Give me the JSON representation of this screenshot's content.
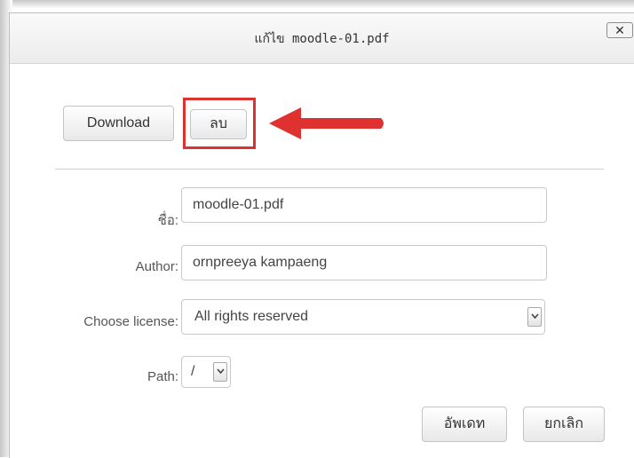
{
  "dialog": {
    "title": "แก้ไข moodle-01.pdf",
    "close_label": "✕"
  },
  "actions": {
    "download_label": "Download",
    "delete_label": "ลบ"
  },
  "form": {
    "name_label": "ชื่อ:",
    "name_value": "moodle-01.pdf",
    "author_label": "Author:",
    "author_value": "ornpreeya kampaeng",
    "license_label": "Choose license:",
    "license_value": "All rights reserved",
    "path_label": "Path:",
    "path_value": "/"
  },
  "footer": {
    "update_label": "อัพเดท",
    "cancel_label": "ยกเลิก"
  },
  "colors": {
    "highlight": "#e03131"
  }
}
